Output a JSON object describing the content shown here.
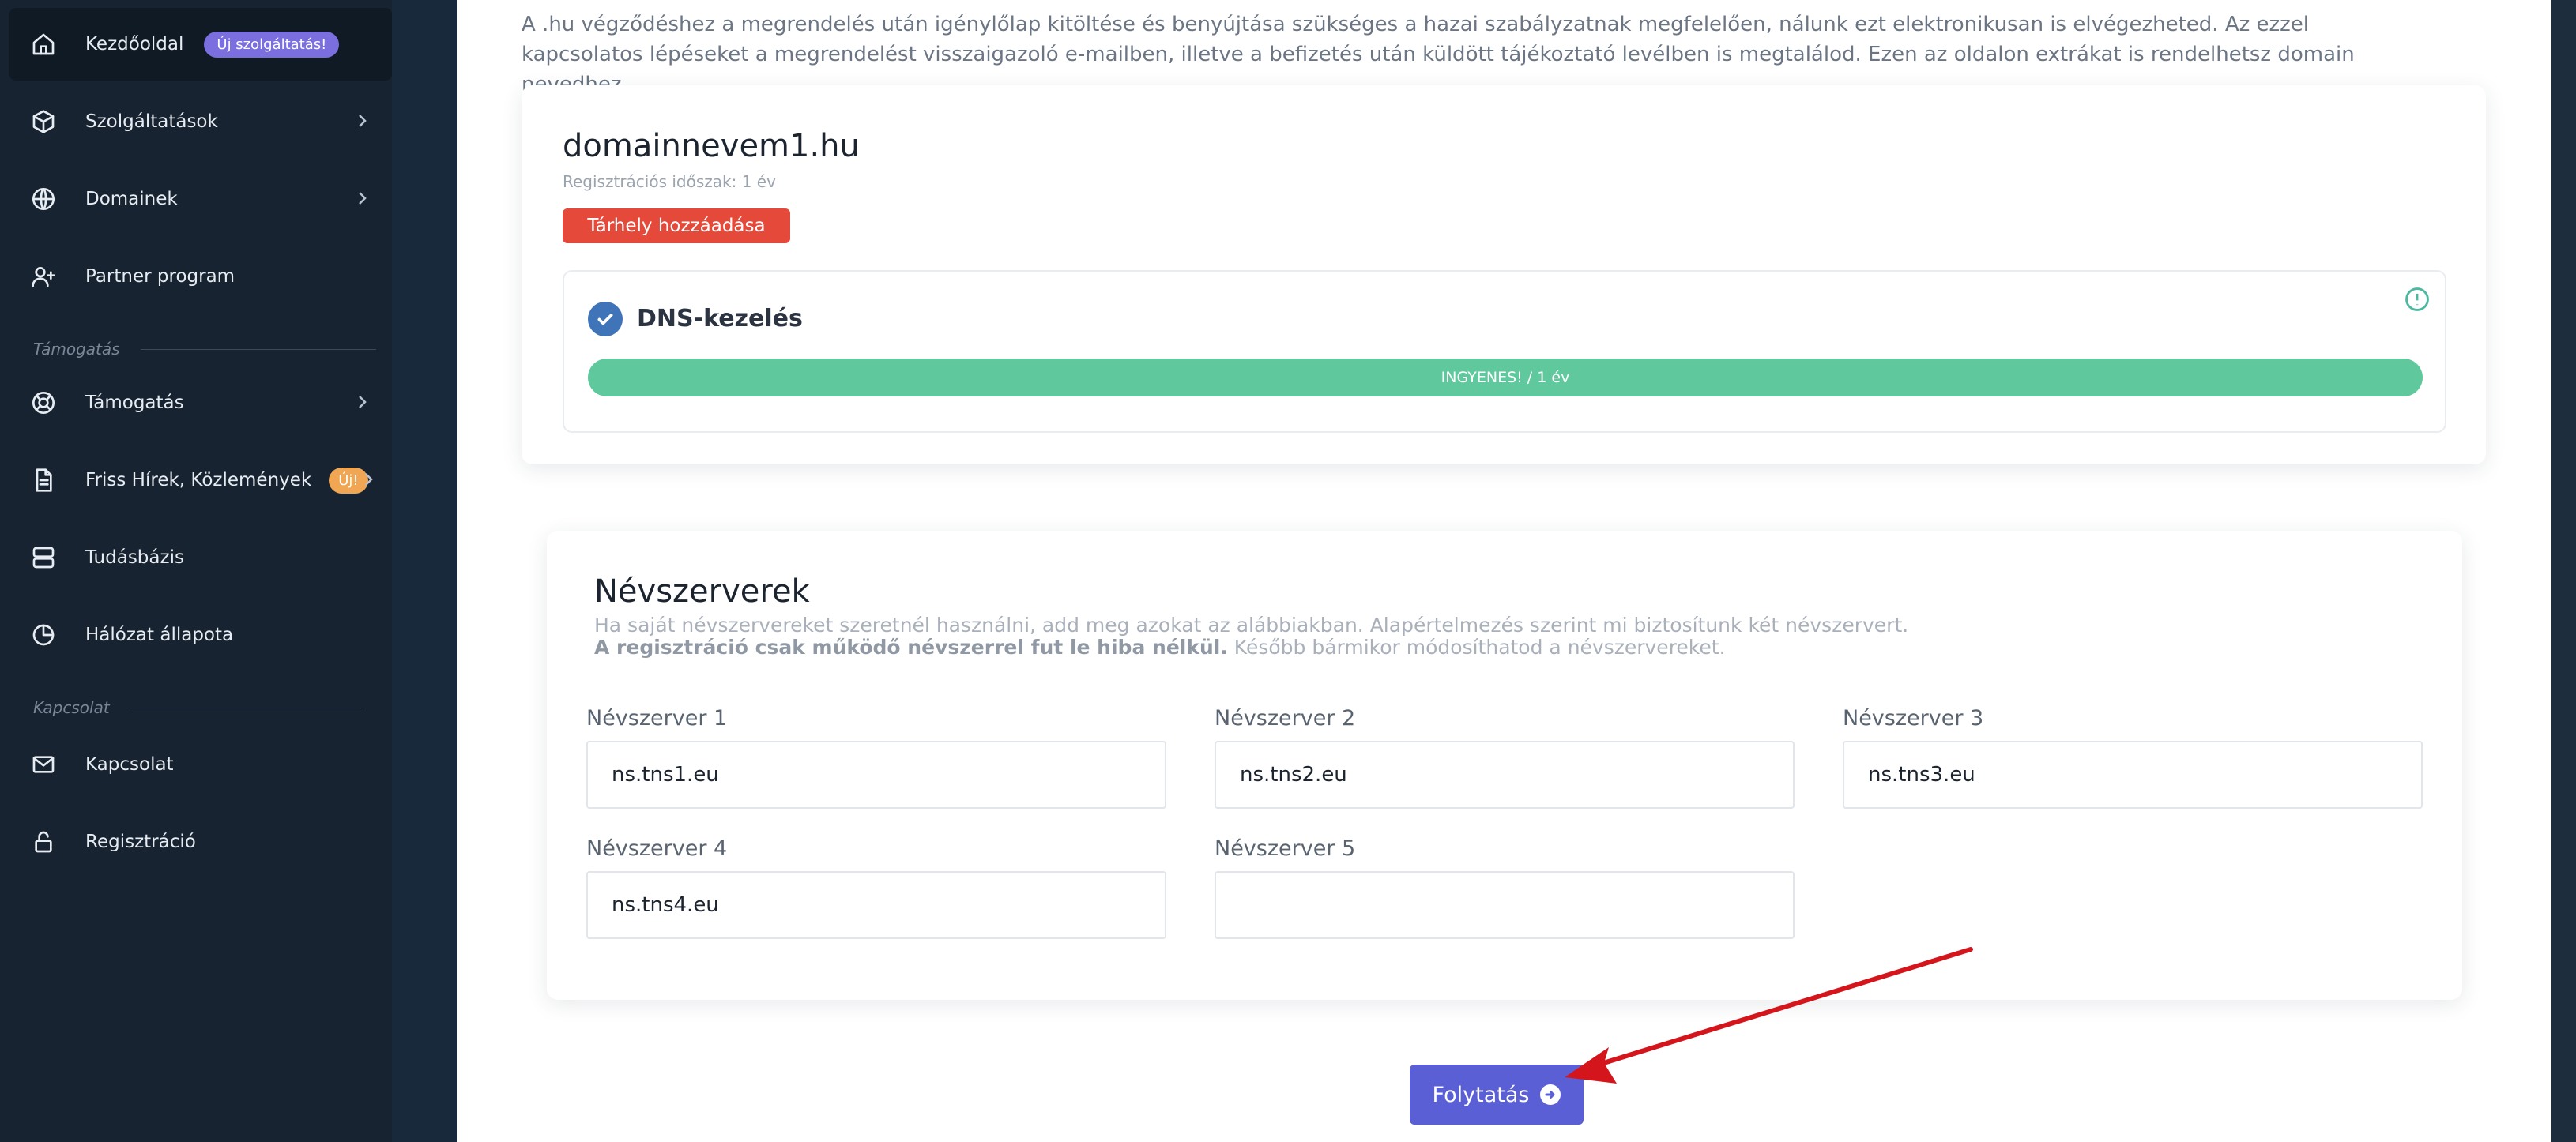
{
  "sidebar": {
    "items": [
      {
        "label": "Kezdőoldal",
        "icon": "home-icon",
        "badge": "Új szolgáltatás!"
      },
      {
        "label": "Szolgáltatások",
        "icon": "box-icon"
      },
      {
        "label": "Domainek",
        "icon": "globe-icon"
      },
      {
        "label": "Partner program",
        "icon": "user-plus-icon"
      },
      {
        "label": "Támogatás",
        "icon": "lifebuoy-icon"
      },
      {
        "label": "Friss Hírek, Közlemények",
        "icon": "document-icon",
        "badge": "Új!"
      },
      {
        "label": "Tudásbázis",
        "icon": "server-icon"
      },
      {
        "label": "Hálózat állapota",
        "icon": "pie-chart-icon"
      },
      {
        "label": "Kapcsolat",
        "icon": "mail-icon"
      },
      {
        "label": "Regisztráció",
        "icon": "lock-icon"
      }
    ],
    "sections": {
      "support": "Támogatás",
      "contact": "Kapcsolat"
    }
  },
  "main": {
    "intro": "A .hu végződéshez a megrendelés után igénylőlap kitöltése és benyújtása szükséges a hazai szabályzatnak megfelelően, nálunk ezt elektronikusan is elvégezheted. Az ezzel kapcsolatos lépéseket a megrendelést visszaigazoló e-mailben, illetve a befizetés után küldött tájékoztató levélben is megtalálod. Ezen az oldalon extrákat is rendelhetsz domain nevedhez.",
    "domain": {
      "name": "domainnevem1.hu",
      "period": "Regisztrációs időszak: 1 év",
      "add_hosting": "Tárhely hozzáadása",
      "dns_title": "DNS-kezelés",
      "dns_price": "INGYENES! / 1 év"
    },
    "nameservers": {
      "title": "Névszerverek",
      "desc_line1": "Ha saját névszervereket szeretnél használni, add meg azokat az alábbiakban. Alapértelmezés szerint mi biztosítunk két névszervert.",
      "desc_bold": "A regisztráció csak működő névszerrel fut le hiba nélkül.",
      "desc_rest": " Később bármikor módosíthatod a névszervereket.",
      "fields": [
        {
          "label": "Névszerver 1",
          "value": "ns.tns1.eu"
        },
        {
          "label": "Névszerver 2",
          "value": "ns.tns2.eu"
        },
        {
          "label": "Névszerver 3",
          "value": "ns.tns3.eu"
        },
        {
          "label": "Névszerver 4",
          "value": "ns.tns4.eu"
        },
        {
          "label": "Névszerver 5",
          "value": ""
        }
      ]
    },
    "continue_label": "Folytatás"
  },
  "colors": {
    "sidebar_bg": "#172331",
    "accent": "#5a5fd6",
    "danger": "#e4493a",
    "success": "#5fc89c",
    "badge_purple": "#7b6fe0",
    "badge_orange": "#f0a652",
    "annotation_arrow": "#d4161c"
  }
}
